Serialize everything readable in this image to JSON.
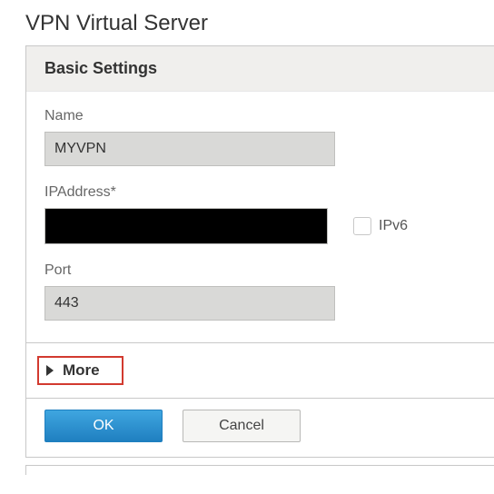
{
  "page": {
    "title": "VPN Virtual Server"
  },
  "section": {
    "title": "Basic Settings"
  },
  "fields": {
    "name": {
      "label": "Name",
      "value": "MYVPN"
    },
    "ip": {
      "label": "IPAddress*",
      "value": ""
    },
    "ipv6": {
      "label": "IPv6",
      "checked": false
    },
    "port": {
      "label": "Port",
      "value": "443"
    }
  },
  "more": {
    "label": "More"
  },
  "buttons": {
    "ok": "OK",
    "cancel": "Cancel"
  }
}
